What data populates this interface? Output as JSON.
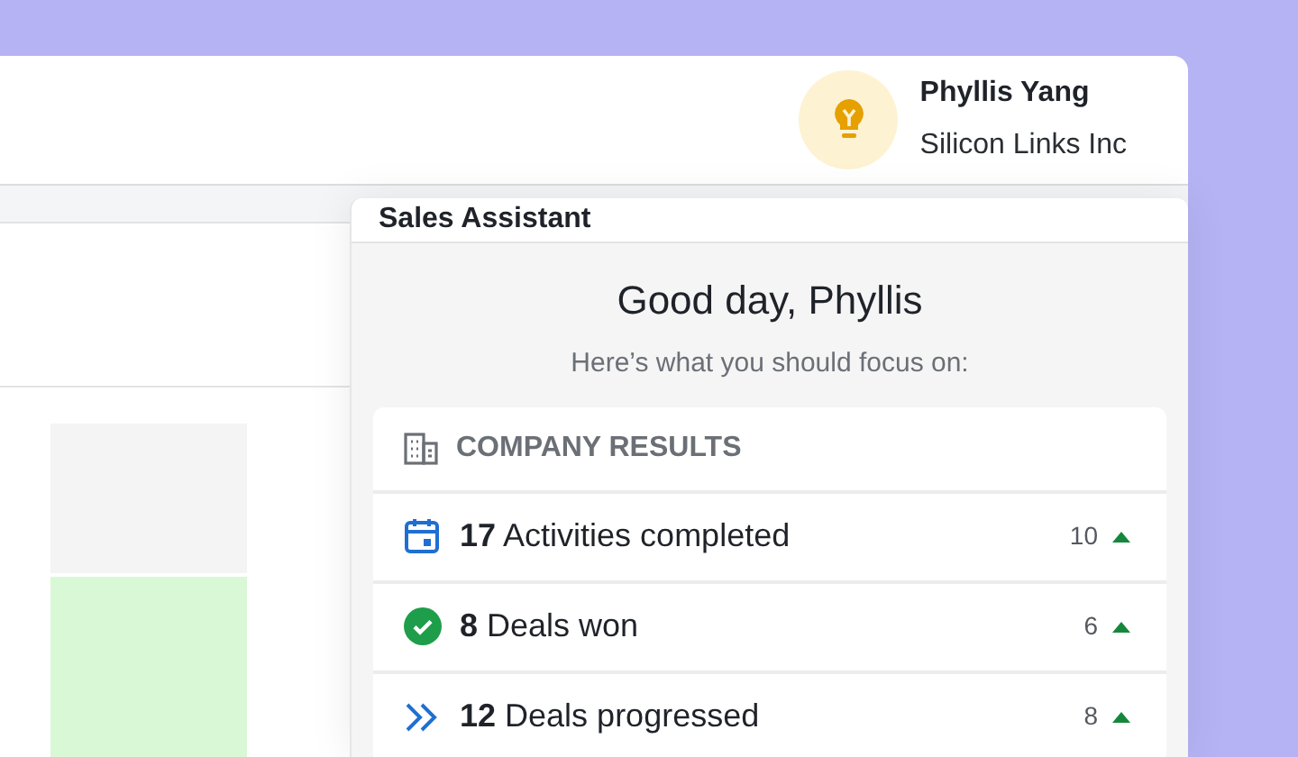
{
  "user": {
    "name": "Phyllis Yang",
    "company": "Silicon Links Inc"
  },
  "assistant": {
    "title": "Sales Assistant",
    "greeting": "Good day, Phyllis",
    "subtitle": "Here’s what you should focus on:",
    "section": "COMPANY RESULTS",
    "results": [
      {
        "kind": "activities",
        "count": "17",
        "label": "Activities completed",
        "previous": "10",
        "rising": true
      },
      {
        "kind": "won",
        "count": "8",
        "label": "Deals won",
        "previous": "6",
        "rising": true
      },
      {
        "kind": "progressed",
        "count": "12",
        "label": "Deals progressed",
        "previous": "8",
        "rising": true
      }
    ]
  }
}
